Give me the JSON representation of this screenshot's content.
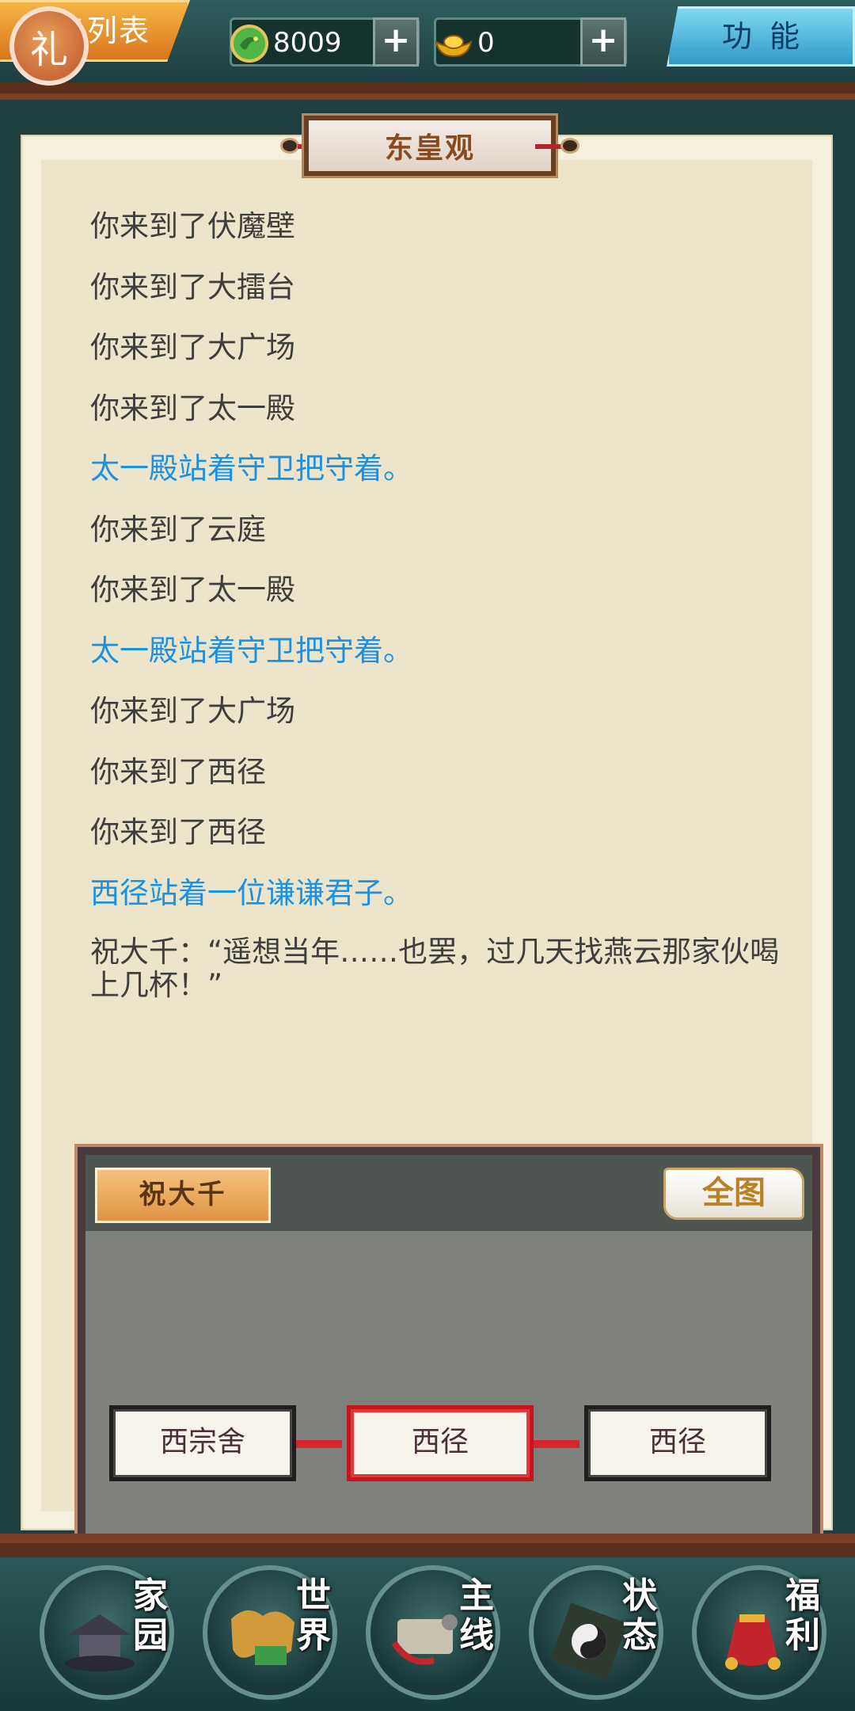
{
  "top_bar": {
    "task_list_label": "务列表",
    "gift_icon_text": "礼",
    "currency_jade": {
      "icon": "jade-dragon-coin-icon",
      "value": "8009",
      "plus": "+"
    },
    "currency_gold": {
      "icon": "gold-ingot-icon",
      "value": "0",
      "plus": "+"
    },
    "function_label": "功能"
  },
  "location_title": "东皇观",
  "log": [
    {
      "text": "你来到了伏魔壁",
      "color": "dark"
    },
    {
      "text": "你来到了大擂台",
      "color": "dark"
    },
    {
      "text": "你来到了大广场",
      "color": "dark"
    },
    {
      "text": "你来到了太一殿",
      "color": "dark"
    },
    {
      "text": "太一殿站着守卫把守着。",
      "color": "blue"
    },
    {
      "text": "你来到了云庭",
      "color": "dark"
    },
    {
      "text": "你来到了太一殿",
      "color": "dark"
    },
    {
      "text": "太一殿站着守卫把守着。",
      "color": "blue"
    },
    {
      "text": "你来到了大广场",
      "color": "dark"
    },
    {
      "text": "你来到了西径",
      "color": "dark"
    },
    {
      "text": "你来到了西径",
      "color": "dark"
    },
    {
      "text": "西径站着一位谦谦君子。",
      "color": "blue"
    }
  ],
  "quote": "祝大千：“遥想当年……也罢，过几天找燕云那家伙喝上几杯！”",
  "map": {
    "npc_name": "祝大千",
    "full_map_label": "全图",
    "nodes": [
      {
        "label": "西宗舍",
        "current": false
      },
      {
        "label": "西径",
        "current": true
      },
      {
        "label": "西径",
        "current": false
      }
    ]
  },
  "bottom_nav": [
    {
      "label": "家园",
      "icon": "home-pavilion-icon"
    },
    {
      "label": "世界",
      "icon": "world-map-icon"
    },
    {
      "label": "主线",
      "icon": "main-quest-scroll-icon"
    },
    {
      "label": "状态",
      "icon": "bagua-status-icon"
    },
    {
      "label": "福利",
      "icon": "lucky-bag-icon"
    }
  ],
  "colors": {
    "log_dark": "#3e3e3e",
    "log_blue": "#1a91e3",
    "accent_orange": "#df9446",
    "accent_red": "#d8242b"
  }
}
